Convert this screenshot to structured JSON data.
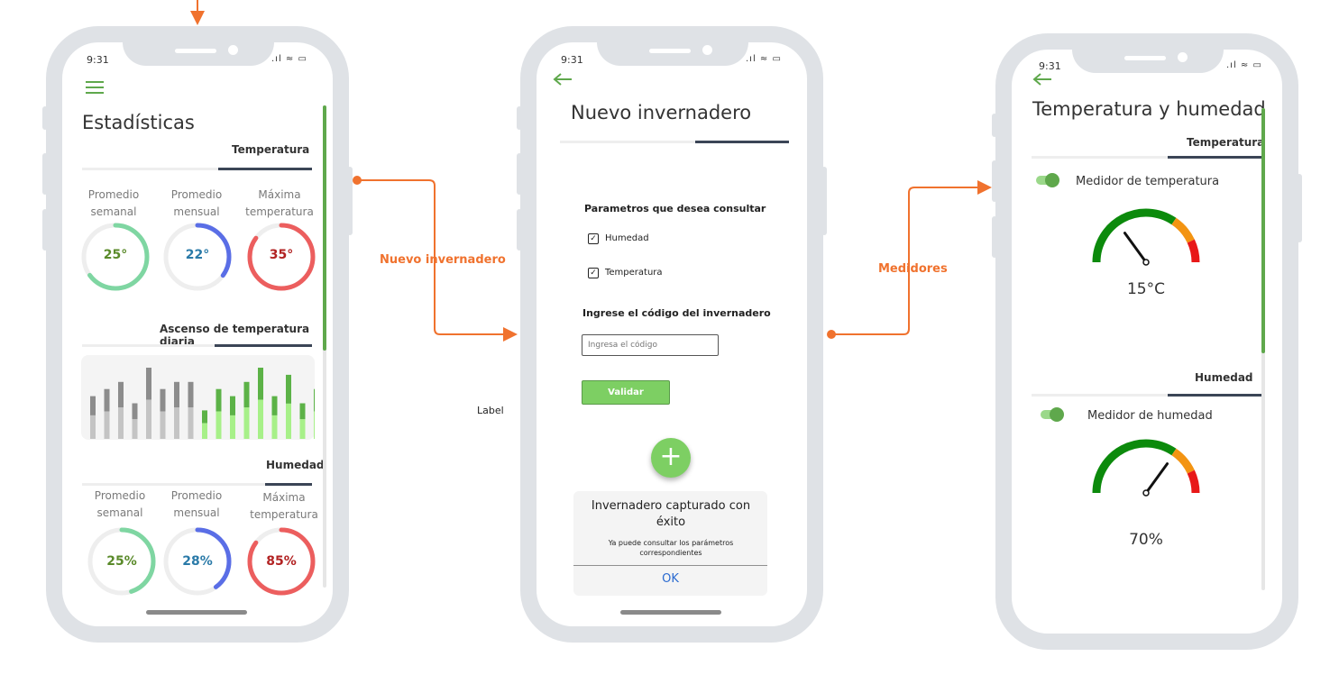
{
  "status": {
    "time": "9:31",
    "icons": ".ıl ≈ ▭"
  },
  "flow": {
    "label_left": "Nuevo invernadero",
    "label_right": "Medidores",
    "label_misc": "Label"
  },
  "screen1": {
    "title": "Estadísticas",
    "temp_tab": "Temperatura",
    "temp_stats": [
      {
        "label": "Promedio semanal",
        "value": "25°",
        "color": "#7fd6a2",
        "text_color": "#5a8a2a",
        "fraction": 0.65
      },
      {
        "label": "Promedio mensual",
        "value": "22°",
        "color": "#5a6ee6",
        "text_color": "#2a7aa8",
        "fraction": 0.35
      },
      {
        "label": "Máxima temperatura",
        "value": "35°",
        "color": "#ec5e5e",
        "text_color": "#b22222",
        "fraction": 0.85
      }
    ],
    "chart_tab": "Ascenso de temperatura diaria",
    "chart_data": {
      "type": "bar",
      "series": [
        {
          "name": "",
          "color": "#8c8c8c",
          "values": [
            6,
            7,
            8,
            5,
            10,
            7,
            8,
            8
          ]
        },
        {
          "name": "",
          "color": "#5cb247",
          "values": [
            4,
            7,
            6,
            8,
            10,
            6,
            9,
            5,
            7
          ]
        }
      ]
    },
    "hum_tab": "Humedad",
    "hum_stats": [
      {
        "label": "Promedio semanal",
        "value": "25%",
        "color": "#7fd6a2",
        "text_color": "#5a8a2a",
        "fraction": 0.45
      },
      {
        "label": "Promedio mensual",
        "value": "28%",
        "color": "#5a6ee6",
        "text_color": "#2a7aa8",
        "fraction": 0.4
      },
      {
        "label": "Máxima temperatura",
        "value": "85%",
        "color": "#ec5e5e",
        "text_color": "#b22222",
        "fraction": 0.85
      }
    ]
  },
  "screen2": {
    "title": "Nuevo invernadero",
    "params_label": "Parametros que desea consultar",
    "check_humedad": "Humedad",
    "check_temperatura": "Temperatura",
    "code_label": "Ingrese el código del invernadero",
    "code_placeholder": "Ingresa el código",
    "validate_label": "Validar",
    "add_symbol": "+",
    "dialog": {
      "title": "Invernadero capturado con éxito",
      "body": "Ya puede consultar los parámetros correspondientes",
      "ok": "OK"
    }
  },
  "screen3": {
    "title": "Temperatura y humedad",
    "temp_tab": "Temperatura",
    "temp_toggle_label": "Medidor de temperatura",
    "temp_value": "15°C",
    "temp_gauge_fraction": 0.3,
    "hum_tab": "Humedad",
    "hum_toggle_label": "Medidor de humedad",
    "hum_value": "70%",
    "hum_gauge_fraction": 0.7
  },
  "colors": {
    "accent": "#5fa84c",
    "flow": "#f0722e",
    "button": "#7dcf63"
  }
}
